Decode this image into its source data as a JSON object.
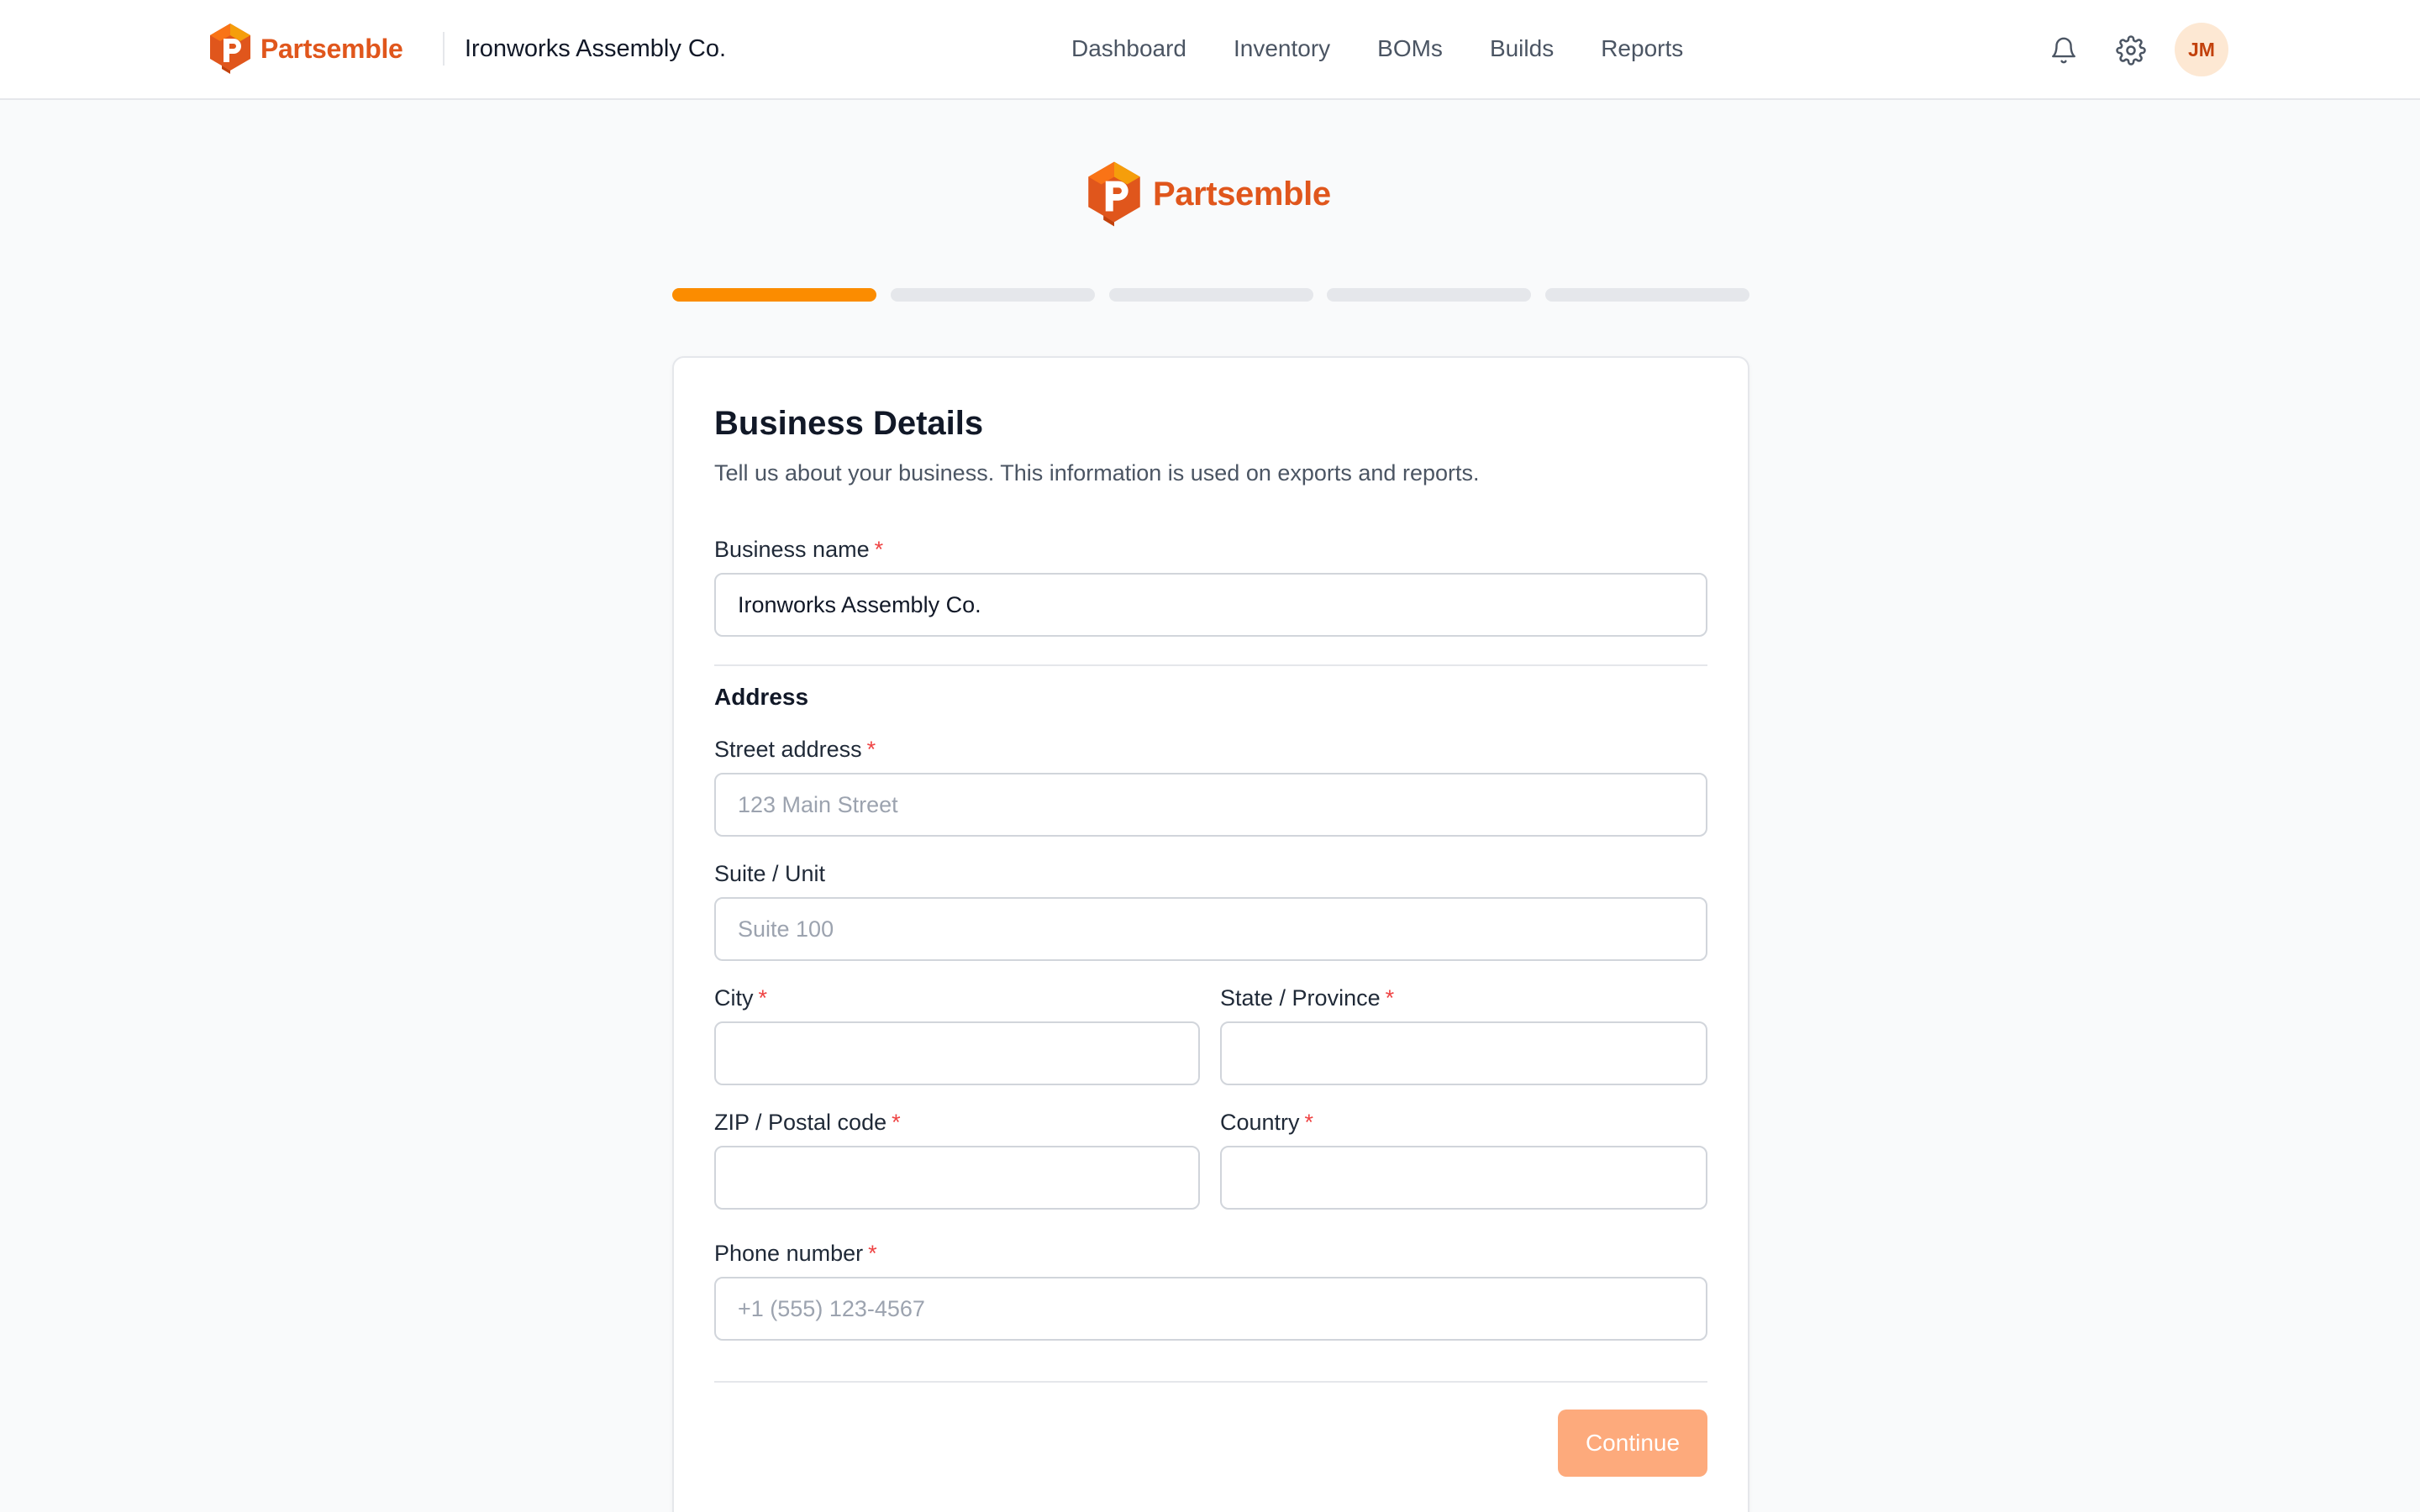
{
  "header": {
    "brand_name": "Partsemble",
    "org_name": "Ironworks Assembly Co.",
    "nav": [
      "Dashboard",
      "Inventory",
      "BOMs",
      "Builds",
      "Reports"
    ],
    "notifications_icon": "bell-icon",
    "settings_icon": "gear-icon",
    "avatar_initials": "JM"
  },
  "hero": {
    "brand_name": "Partsemble"
  },
  "steps": {
    "total": 5,
    "current": 1
  },
  "form": {
    "title": "Business Details",
    "subtitle": "Tell us about your business. This information is used on exports and reports.",
    "required_marker": "*",
    "business_name": {
      "label": "Business name",
      "value": "Ironworks Assembly Co.",
      "placeholder": ""
    },
    "address_title": "Address",
    "street": {
      "label": "Street address",
      "value": "",
      "placeholder": "123 Main Street"
    },
    "suite": {
      "label": "Suite / Unit",
      "value": "",
      "placeholder": "Suite 100"
    },
    "city": {
      "label": "City",
      "value": "",
      "placeholder": ""
    },
    "state": {
      "label": "State / Province",
      "value": "",
      "placeholder": ""
    },
    "zip": {
      "label": "ZIP / Postal code",
      "value": "",
      "placeholder": ""
    },
    "country": {
      "label": "Country",
      "value": "",
      "placeholder": ""
    },
    "phone": {
      "label": "Phone number",
      "value": "",
      "placeholder": "+1 (555) 123-4567"
    },
    "continue_label": "Continue"
  },
  "colors": {
    "brand": "#e0561c",
    "step_active": "#fb8c00",
    "step_inactive": "#e5e7eb",
    "button_disabled": "#fdaa7c",
    "required": "#ef4444"
  }
}
